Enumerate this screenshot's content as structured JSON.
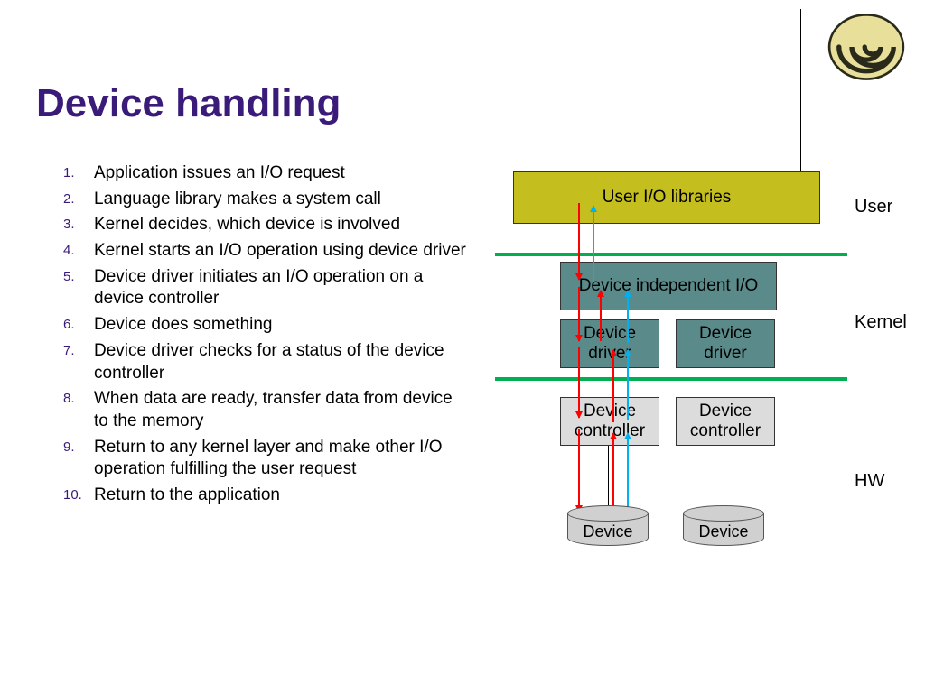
{
  "title": "Device handling",
  "steps": [
    "Application issues an I/O request",
    "Language library makes a system call",
    "Kernel decides, which device is involved",
    "Kernel starts an I/O operation using device driver",
    "Device driver initiates an I/O operation on a device controller",
    "Device does something",
    "Device driver checks for a status of the device controller",
    "When data are ready, transfer data from device to the memory",
    "Return to any kernel layer and make other I/O operation fulfilling the user request",
    "Return to the application"
  ],
  "diagram": {
    "user_io_libraries": "User I/O libraries",
    "device_independent_io": "Device independent I/O",
    "device_driver_1": "Device driver",
    "device_driver_2": "Device driver",
    "device_controller_1": "Device controller",
    "device_controller_2": "Device controller",
    "device_1": "Device",
    "device_2": "Device",
    "labels": {
      "user": "User",
      "kernel": "Kernel",
      "hw": "HW"
    }
  }
}
